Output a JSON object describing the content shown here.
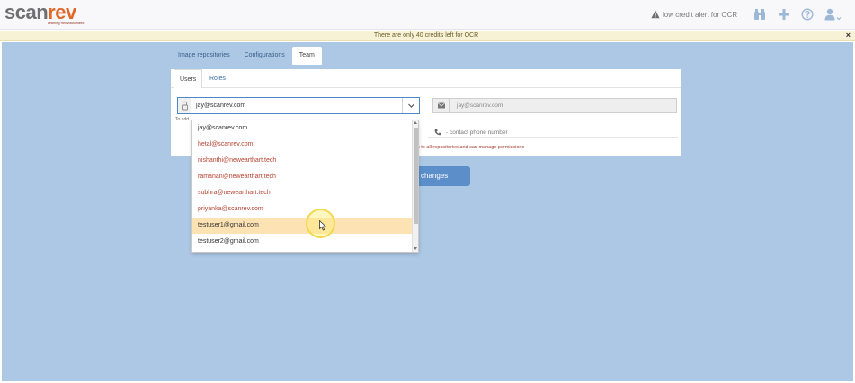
{
  "app": {
    "logo_main_a": "scan",
    "logo_main_b": "rev",
    "logo_tagline": "Learning Reinvolutionized"
  },
  "topbar": {
    "credit_alert": "low credit alert for OCR",
    "icons": [
      "binoculars-icon",
      "plus-icon",
      "help-icon",
      "user-menu-icon"
    ]
  },
  "banner": {
    "text": "There are only 40 credits left for OCR",
    "close": "×"
  },
  "tabs": [
    {
      "label": "Image repositories",
      "active": false
    },
    {
      "label": "Configurations",
      "active": false
    },
    {
      "label": "Team",
      "active": true
    }
  ],
  "subtabs": [
    {
      "label": "Users",
      "active": true
    },
    {
      "label": "Roles",
      "active": false
    }
  ],
  "user_select": {
    "value": "jay@scanrev.com"
  },
  "email_field": {
    "value": "jay@scanrev.com"
  },
  "hint": {
    "add": "To add"
  },
  "phone": {
    "label": "- contact phone number"
  },
  "permission_note": "s to all repositories and can manage permissions",
  "save_button": {
    "label": "changes"
  },
  "dropdown": {
    "items": [
      {
        "email": "jay@scanrev.com",
        "style": "black"
      },
      {
        "email": "hetal@scanrev.com",
        "style": "red"
      },
      {
        "email": "nishanthi@newearthart.tech",
        "style": "red"
      },
      {
        "email": "ramanan@newearthart.tech",
        "style": "red"
      },
      {
        "email": "subhra@newearthart.tech",
        "style": "red"
      },
      {
        "email": "priyanka@scanrev.com",
        "style": "red"
      },
      {
        "email": "testuser1@gmail.com",
        "style": "black",
        "highlighted": true
      },
      {
        "email": "testuser2@gmail.com",
        "style": "black"
      }
    ]
  },
  "colors": {
    "background": "#adc8e4",
    "accent": "#5c8fca",
    "banner": "#f7f1d6",
    "highlight": "#fde3b4",
    "logo_orange": "#e0692a"
  }
}
